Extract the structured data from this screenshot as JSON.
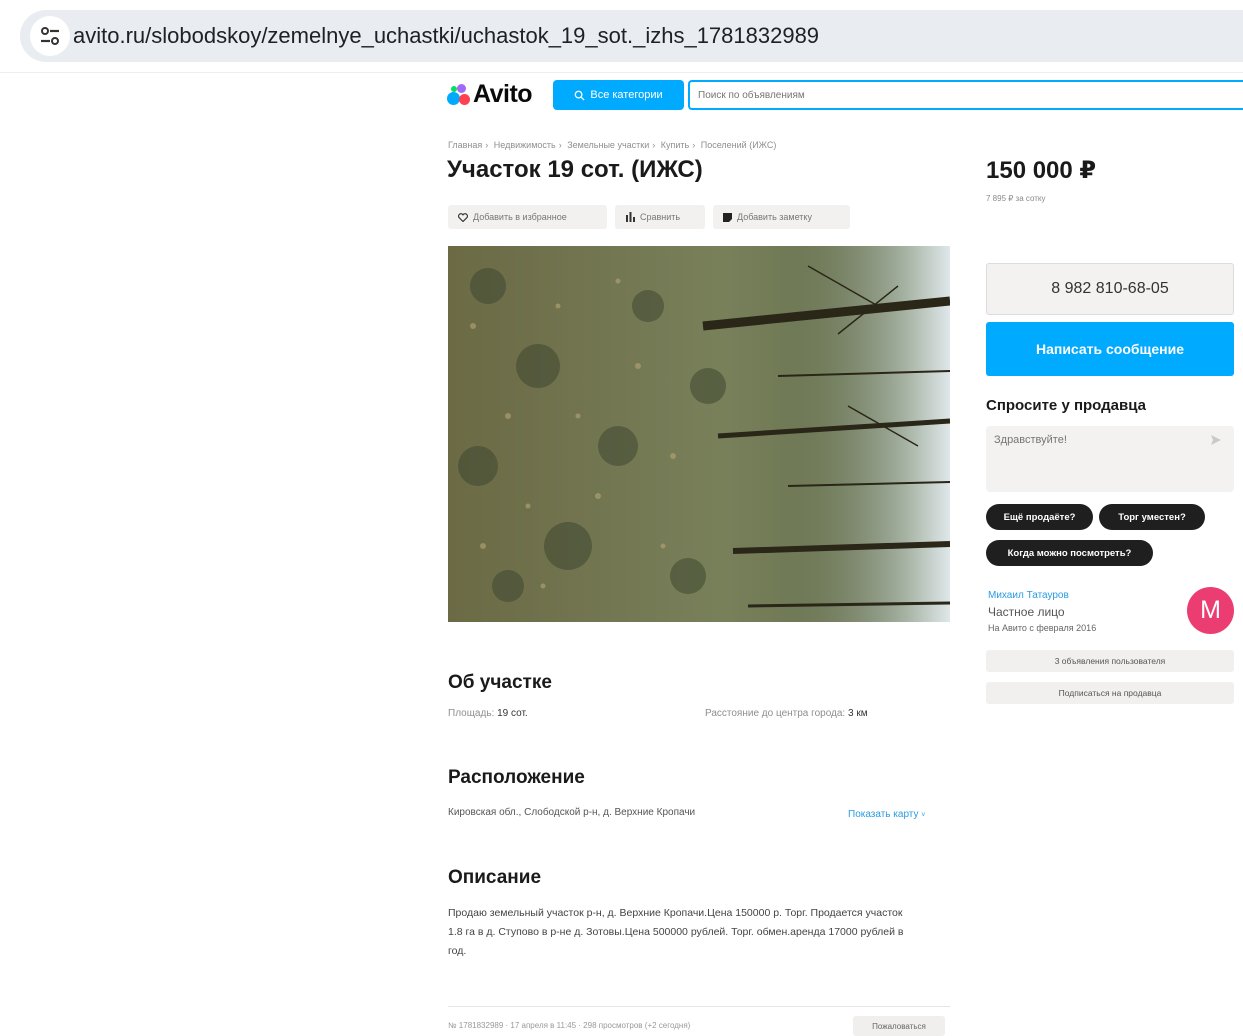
{
  "browser": {
    "url": "avito.ru/slobodskoy/zemelnye_uchastki/uchastok_19_sot._izhs_1781832989",
    "site_icon": "tune-icon"
  },
  "header": {
    "logo_text": "Avito",
    "categories_button": "Все категории",
    "search_placeholder": "Поиск по объявлениям"
  },
  "breadcrumb": [
    "Главная",
    "Недвижимость",
    "Земельные участки",
    "Купить",
    "Поселений (ИЖС)"
  ],
  "listing": {
    "title": "Участок 19 сот. (ИЖС)",
    "actions": {
      "favorite": "Добавить в избранное",
      "compare": "Сравнить",
      "note": "Добавить заметку"
    }
  },
  "about": {
    "heading": "Об участке",
    "area_label": "Площадь:",
    "area_value": "19 сот.",
    "distance_label": "Расстояние до центра города:",
    "distance_value": "3 км"
  },
  "location": {
    "heading": "Расположение",
    "address": "Кировская обл., Слободской р-н, д. Верхние Кропачи",
    "map_link": "Показать карту"
  },
  "description": {
    "heading": "Описание",
    "text": "Продаю земельный участок р-н, д. Верхние Кропачи.Цена 150000 р. Торг. Продается участок 1.8 га в д. Ступово в р-не д. Зотовы.Цена 500000 рублей. Торг. обмен.аренда 17000 рублей в год."
  },
  "footer": {
    "meta": "№ 1781832989 · 17 апреля в 11:45 · 298 просмотров (+2 сегодня)",
    "complain": "Пожаловаться"
  },
  "sidebar": {
    "price": "150 000 ₽",
    "price_per": "7 895 ₽ за сотку",
    "phone": "8 982 810-68-05",
    "message_button": "Написать сообщение",
    "ask_title": "Спросите у продавца",
    "ask_placeholder": "Здравствуйте!",
    "chips": [
      "Ещё продаёте?",
      "Торг уместен?",
      "Когда можно посмотреть?"
    ],
    "seller": {
      "name": "Михаил Татауров",
      "type": "Частное лицо",
      "since": "На Авито с февраля 2016",
      "avatar_letter": "M"
    },
    "seller_ads_button": "3 объявления пользователя",
    "subscribe_button": "Подписаться на продавца"
  },
  "colors": {
    "accent": "#00aaff",
    "link": "#2a9be0",
    "avatar": "#ec3d72",
    "chip": "#1f1f1f"
  }
}
